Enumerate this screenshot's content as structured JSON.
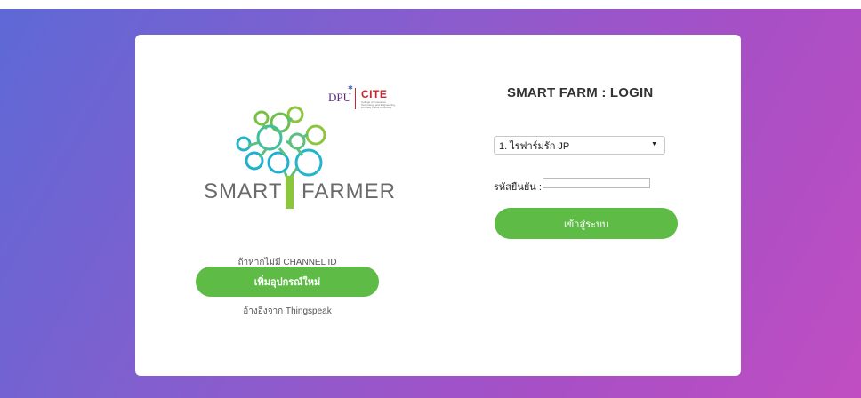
{
  "brand": {
    "word_left": "SMART",
    "word_right": "FARMER",
    "partner_logo_1": "DPU",
    "partner_logo_2": "CITE",
    "partner_logo_2_subtitle": "College of Innovative Technology and Engineering, Dhurakij Pundit University",
    "accent_green": "#8cc63f",
    "button_green": "#5dbb46"
  },
  "left": {
    "no_channel_text": "ถ้าหากไม่มี CHANNEL ID",
    "add_device_label": "เพิ่มอุปกรณ์ใหม่",
    "reference_text": "อ้างอิงจาก Thingspeak"
  },
  "login": {
    "title": "SMART FARM : LOGIN",
    "farm_select_value": "1. ไร่ฟาร์มรัก JP",
    "code_label": "รหัสยืนยัน :",
    "code_value": "",
    "submit_label": "เข้าสู่ระบบ"
  },
  "icons": {
    "tree_logo": "tree-circles-icon",
    "select_caret": "caret-down-icon"
  }
}
